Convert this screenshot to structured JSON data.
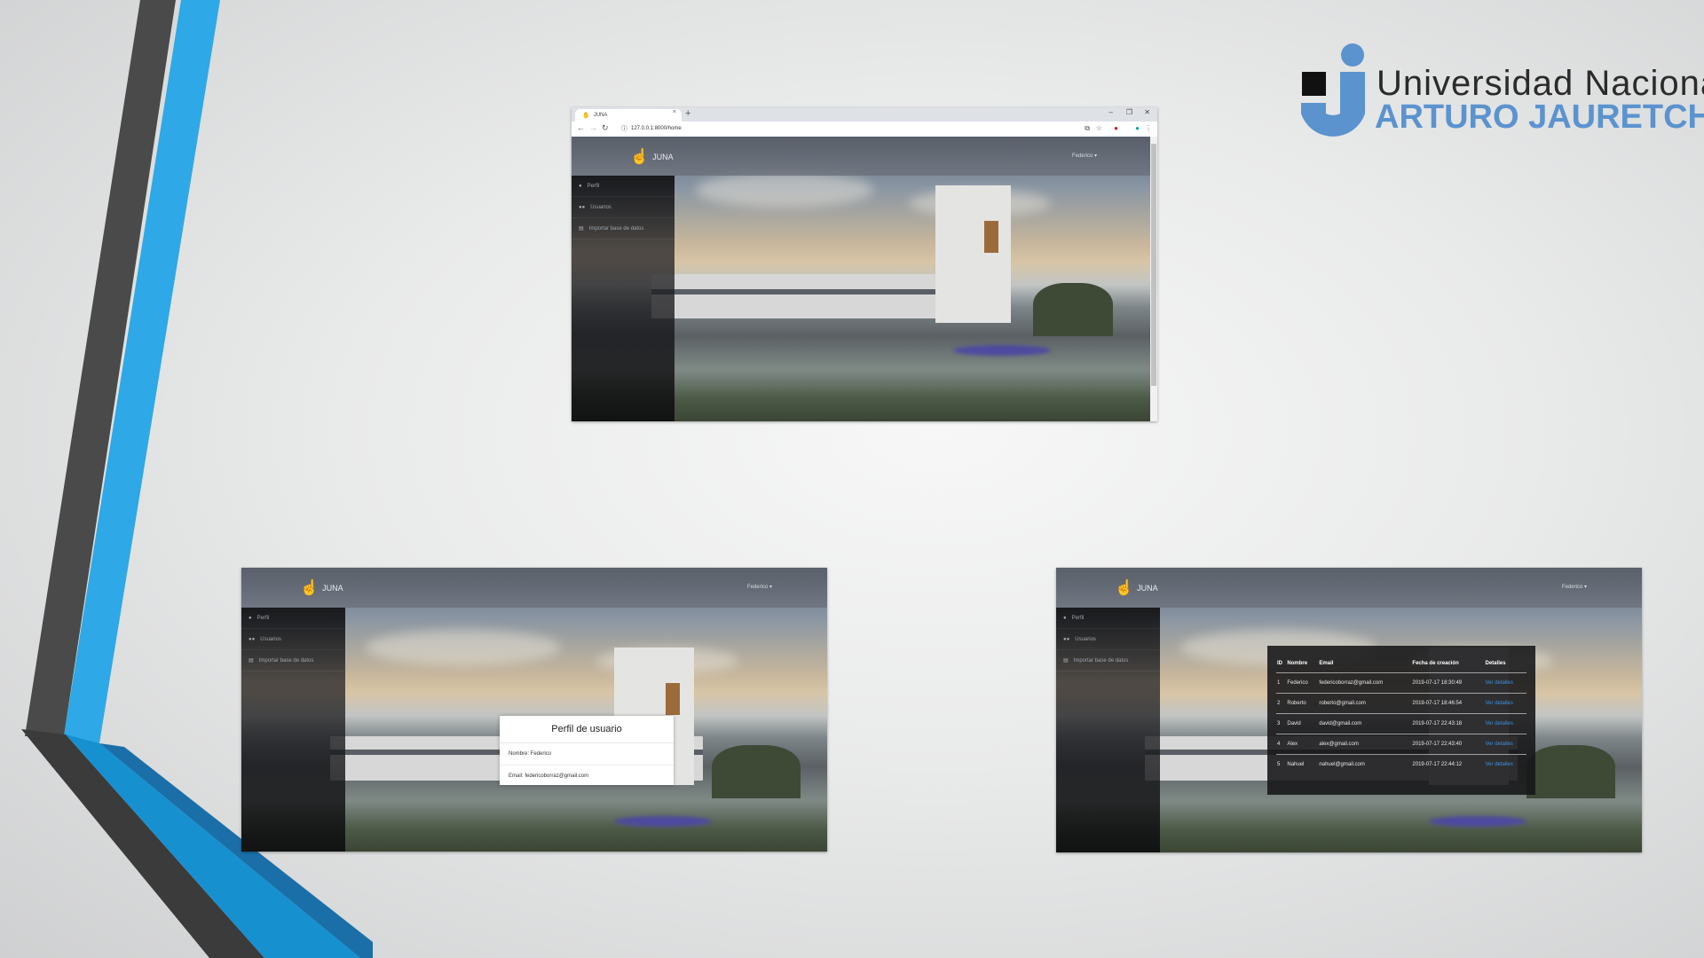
{
  "university": {
    "name_line1": "Universidad Nacional",
    "name_line2": "ARTURO JAURETCHE"
  },
  "colors": {
    "accent_blue": "#2ea8e6",
    "stripe_dark": "#4a4a4a",
    "logo_blue": "#5b93cf",
    "link_blue": "#3d8fe0"
  },
  "browser": {
    "tab_title": "JUNA",
    "tab_close": "×",
    "new_tab": "+",
    "url": "127.0.0.1:8000/home",
    "window_controls": [
      "–",
      "❐",
      "✕"
    ]
  },
  "app": {
    "brand": "JUNA",
    "user_menu": "Federico ▾",
    "sidebar": [
      {
        "label": "Perfil",
        "icon": "user-icon"
      },
      {
        "label": "Usuarios",
        "icon": "users-icon"
      },
      {
        "label": "Importar base de datos",
        "icon": "database-icon"
      }
    ]
  },
  "profile": {
    "title": "Perfil de usuario",
    "name_row": "Nombre: Federico",
    "email_row": "Email: federicoborraz@gmail.com"
  },
  "users": {
    "headers": [
      "ID",
      "Nombre",
      "Email",
      "Fecha de creación",
      "Detalles"
    ],
    "rows": [
      [
        "1",
        "Federico",
        "federicoborraz@gmail.com",
        "2019-07-17 18:30:49",
        "Ver detalles"
      ],
      [
        "2",
        "Roberto",
        "roberto@gmail.com",
        "2019-07-17 18:46:54",
        "Ver detalles"
      ],
      [
        "3",
        "David",
        "david@gmail.com",
        "2019-07-17 22:43:18",
        "Ver detalles"
      ],
      [
        "4",
        "Alex",
        "alex@gmail.com",
        "2019-07-17 22:43:40",
        "Ver detalles"
      ],
      [
        "5",
        "Nahuel",
        "nahuel@gmail.com",
        "2019-07-17 22:44:12",
        "Ver detalles"
      ]
    ]
  }
}
